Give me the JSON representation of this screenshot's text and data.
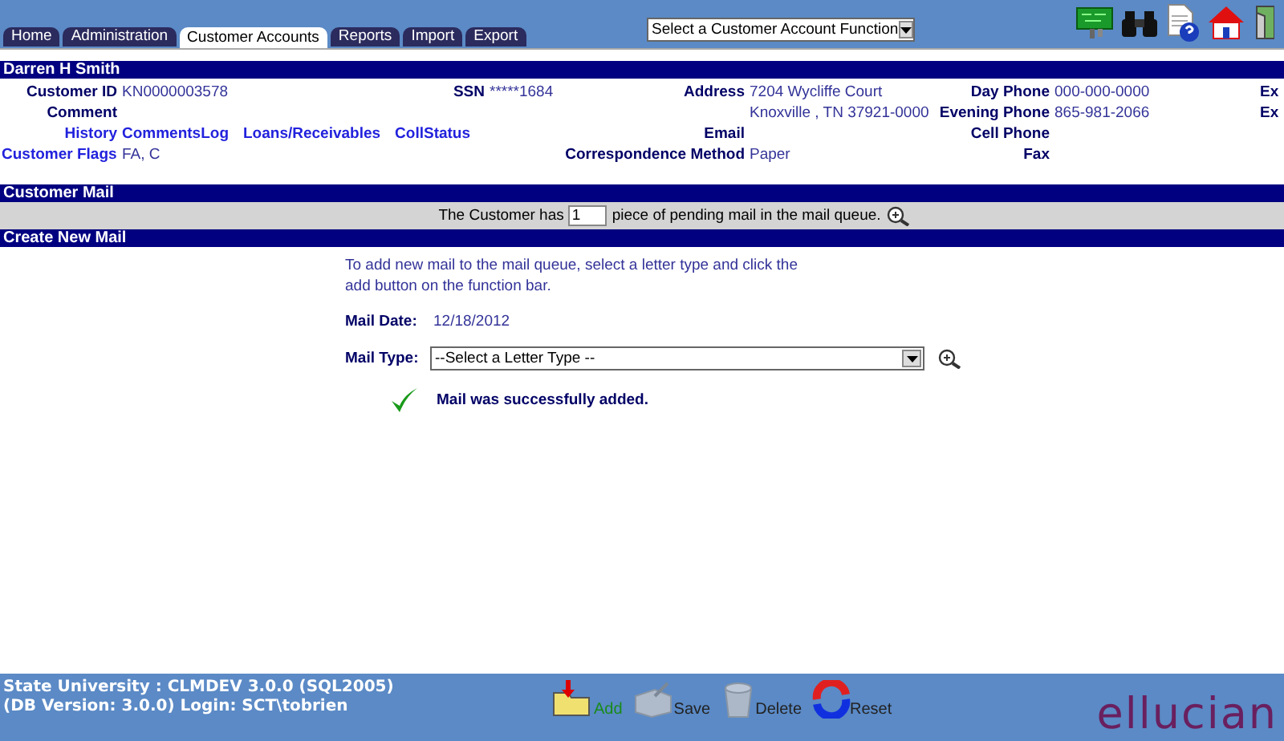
{
  "tabs": [
    {
      "label": "Home",
      "selected": false
    },
    {
      "label": "Administration",
      "selected": false
    },
    {
      "label": "Customer Accounts",
      "selected": true
    },
    {
      "label": "Reports",
      "selected": false
    },
    {
      "label": "Import",
      "selected": false
    },
    {
      "label": "Export",
      "selected": false
    }
  ],
  "function_select": {
    "value": "Select a Customer Account Function"
  },
  "customer": {
    "name": "Darren H Smith",
    "customer_id": {
      "label": "Customer ID",
      "value": "KN0000003578"
    },
    "ssn": {
      "label": "SSN",
      "value": "*****1684"
    },
    "address": {
      "label": "Address",
      "lines": [
        "7204 Wycliffe Court",
        "Knoxville , TN 37921-0000"
      ]
    },
    "day_phone": {
      "label": "Day Phone",
      "value": "000-000-0000"
    },
    "evening_phone": {
      "label": "Evening Phone",
      "value": "865-981-2066"
    },
    "extensions": [
      "Ex",
      "Ex"
    ],
    "comment": {
      "label": "Comment"
    },
    "history": {
      "label": "History",
      "links": [
        "CommentsLog",
        "Loans/Receivables",
        "CollStatus"
      ]
    },
    "email": {
      "label": "Email"
    },
    "cell_phone": {
      "label": "Cell Phone"
    },
    "flags": {
      "label": "Customer Flags",
      "value": "FA, C"
    },
    "correspondence": {
      "label": "Correspondence Method",
      "value": "Paper"
    },
    "fax": {
      "label": "Fax"
    }
  },
  "customer_mail": {
    "title": "Customer Mail",
    "text_before": "The Customer has",
    "count": "1",
    "text_after": "piece of pending mail in the mail queue."
  },
  "create_mail": {
    "title": "Create New Mail",
    "instructions": "To add new mail to the mail queue, select a letter type and click the add button on the function bar.",
    "date_label": "Mail Date:",
    "date": "12/18/2012",
    "type_label": "Mail Type:",
    "type_value": "--Select a Letter Type --",
    "message": "Mail was successfully added."
  },
  "footer": {
    "lines": [
      "State University : CLMDEV 3.0.0 (SQL2005)",
      "(DB Version: 3.0.0) Login: SCT\\tobrien"
    ],
    "actions": [
      {
        "kind": "add",
        "label": "Add",
        "disabled": false
      },
      {
        "kind": "save",
        "label": "Save",
        "disabled": true
      },
      {
        "kind": "delete",
        "label": "Delete",
        "disabled": true
      },
      {
        "kind": "reset",
        "label": "Reset",
        "disabled": false
      }
    ],
    "logo": "ellucian"
  }
}
